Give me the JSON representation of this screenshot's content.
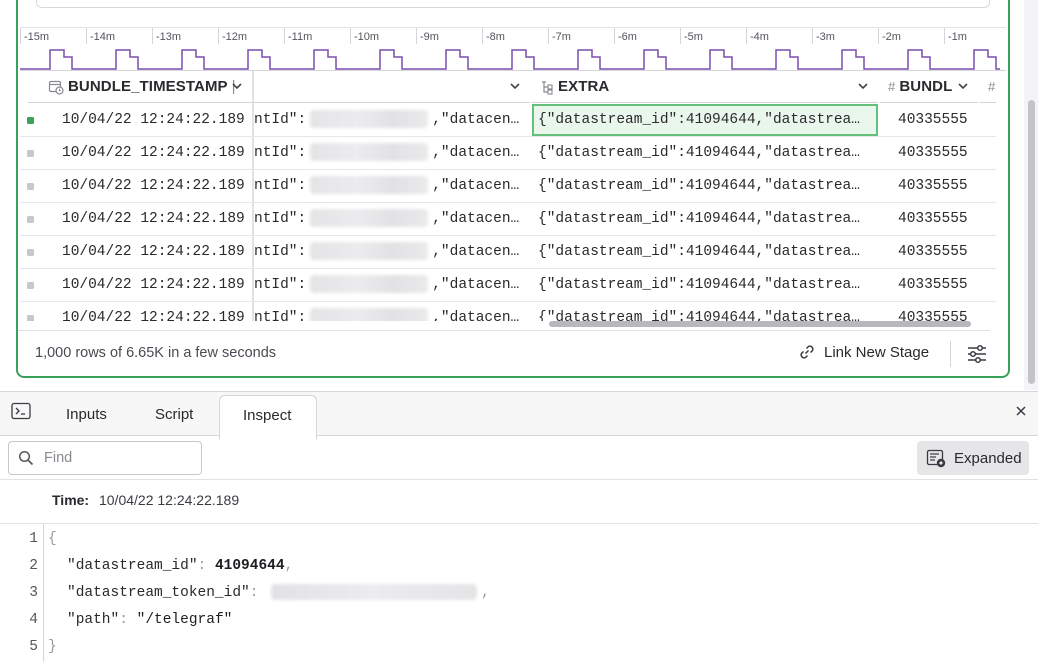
{
  "timeline": {
    "ticks": [
      "-15m",
      "-14m",
      "-13m",
      "-12m",
      "-11m",
      "-10m",
      "-9m",
      "-8m",
      "-7m",
      "-6m",
      "-5m",
      "-4m",
      "-3m",
      "-2m",
      "-1m"
    ],
    "line_color": "#7a4fb0"
  },
  "table": {
    "columns": [
      {
        "name": "BUNDLE_TIMESTAMP",
        "type_icon": "clock-calendar-icon"
      },
      {
        "name": "",
        "type_icon": ""
      },
      {
        "name": "EXTRA",
        "type_icon": "object-icon"
      },
      {
        "name": "BUNDL",
        "type_icon": "#"
      },
      {
        "name": "",
        "type_icon": "#"
      }
    ],
    "rows": [
      {
        "timestamp": "10/04/22 12:24:22.189",
        "field_prefix": "ntId\":",
        "field_suffix": ",\"datacen…",
        "extra": "{\"datastream_id\":41094644,\"datastrea…",
        "bundle": "40335555",
        "active": true
      },
      {
        "timestamp": "10/04/22 12:24:22.189",
        "field_prefix": "ntId\":",
        "field_suffix": ",\"datacen…",
        "extra": "{\"datastream_id\":41094644,\"datastrea…",
        "bundle": "40335555",
        "active": false
      },
      {
        "timestamp": "10/04/22 12:24:22.189",
        "field_prefix": "ntId\":",
        "field_suffix": ",\"datacen…",
        "extra": "{\"datastream_id\":41094644,\"datastrea…",
        "bundle": "40335555",
        "active": false
      },
      {
        "timestamp": "10/04/22 12:24:22.189",
        "field_prefix": "ntId\":",
        "field_suffix": ",\"datacen…",
        "extra": "{\"datastream_id\":41094644,\"datastrea…",
        "bundle": "40335555",
        "active": false
      },
      {
        "timestamp": "10/04/22 12:24:22.189",
        "field_prefix": "ntId\":",
        "field_suffix": ",\"datacen…",
        "extra": "{\"datastream_id\":41094644,\"datastrea…",
        "bundle": "40335555",
        "active": false
      },
      {
        "timestamp": "10/04/22 12:24:22.189",
        "field_prefix": "ntId\":",
        "field_suffix": ",\"datacen…",
        "extra": "{\"datastream_id\":41094644,\"datastrea…",
        "bundle": "40335555",
        "active": false
      },
      {
        "timestamp": "10/04/22 12:24:22.189",
        "field_prefix": "ntId\":",
        "field_suffix": ",\"datacen…",
        "extra": "{\"datastream_id\":41094644,\"datastrea…",
        "bundle": "40335555",
        "active": false
      }
    ]
  },
  "footer": {
    "row_count": "1,000 rows of 6.65K in a few seconds",
    "link_new_stage": "Link New Stage",
    "settings_icon": "sliders-icon"
  },
  "console": {
    "tabs": [
      "Inputs",
      "Script",
      "Inspect"
    ],
    "active_tab": "Inspect",
    "find_placeholder": "Find",
    "expanded_label": "Expanded",
    "time_label": "Time:",
    "time_value": "10/04/22 12:24:22.189",
    "code_lines": [
      {
        "n": "1",
        "text": "{"
      },
      {
        "n": "2",
        "key": "\"datastream_id\"",
        "value": "41094644"
      },
      {
        "n": "3",
        "key": "\"datastream_token_id\"",
        "value": ""
      },
      {
        "n": "4",
        "key": "\"path\"",
        "value": "\"/telegraf\""
      },
      {
        "n": "5",
        "text": "}"
      }
    ]
  },
  "colors": {
    "accent_green": "#3aa05a",
    "selected_cell_bg": "#eaf7ec"
  }
}
